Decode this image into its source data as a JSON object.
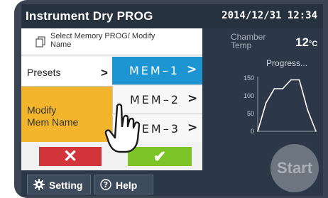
{
  "header": {
    "title": "Instrument Dry PROG",
    "datetime": "2014/12/31 12:34"
  },
  "section": {
    "title": "Select Memory PROG/ Modify Name",
    "icon": "memory-stack-icon"
  },
  "menu": {
    "presets_label": "Presets",
    "modify_label_line1": "Modify",
    "modify_label_line2": "Mem Name",
    "chevron": ">"
  },
  "memories": [
    {
      "label": "MEM–1"
    },
    {
      "label": "MEM–2"
    },
    {
      "label": "MEM–3"
    }
  ],
  "actions": {
    "cancel_label": "✕",
    "ok_label": "✔"
  },
  "status": {
    "chamber_label": "Chamber Temp",
    "chamber_value": "12",
    "chamber_unit": "°C",
    "progress_label": "Progress..."
  },
  "chart_data": {
    "type": "line",
    "y_ticks": [
      "150",
      "100",
      "50",
      "0"
    ],
    "ylim": [
      0,
      150
    ],
    "x": [
      0,
      1,
      2,
      3,
      4,
      5,
      6,
      7
    ],
    "series": [
      {
        "values": [
          0,
          80,
          120,
          120,
          145,
          145,
          60,
          0
        ]
      }
    ],
    "line_color": "#ffffff"
  },
  "start_label": "Start",
  "bottom": {
    "setting_label": "Setting",
    "help_label": "Help"
  },
  "colors": {
    "accent_blue": "#1e95d3",
    "accent_orange": "#f3b52c",
    "cancel_red": "#d3353d",
    "ok_green": "#7cc427"
  }
}
